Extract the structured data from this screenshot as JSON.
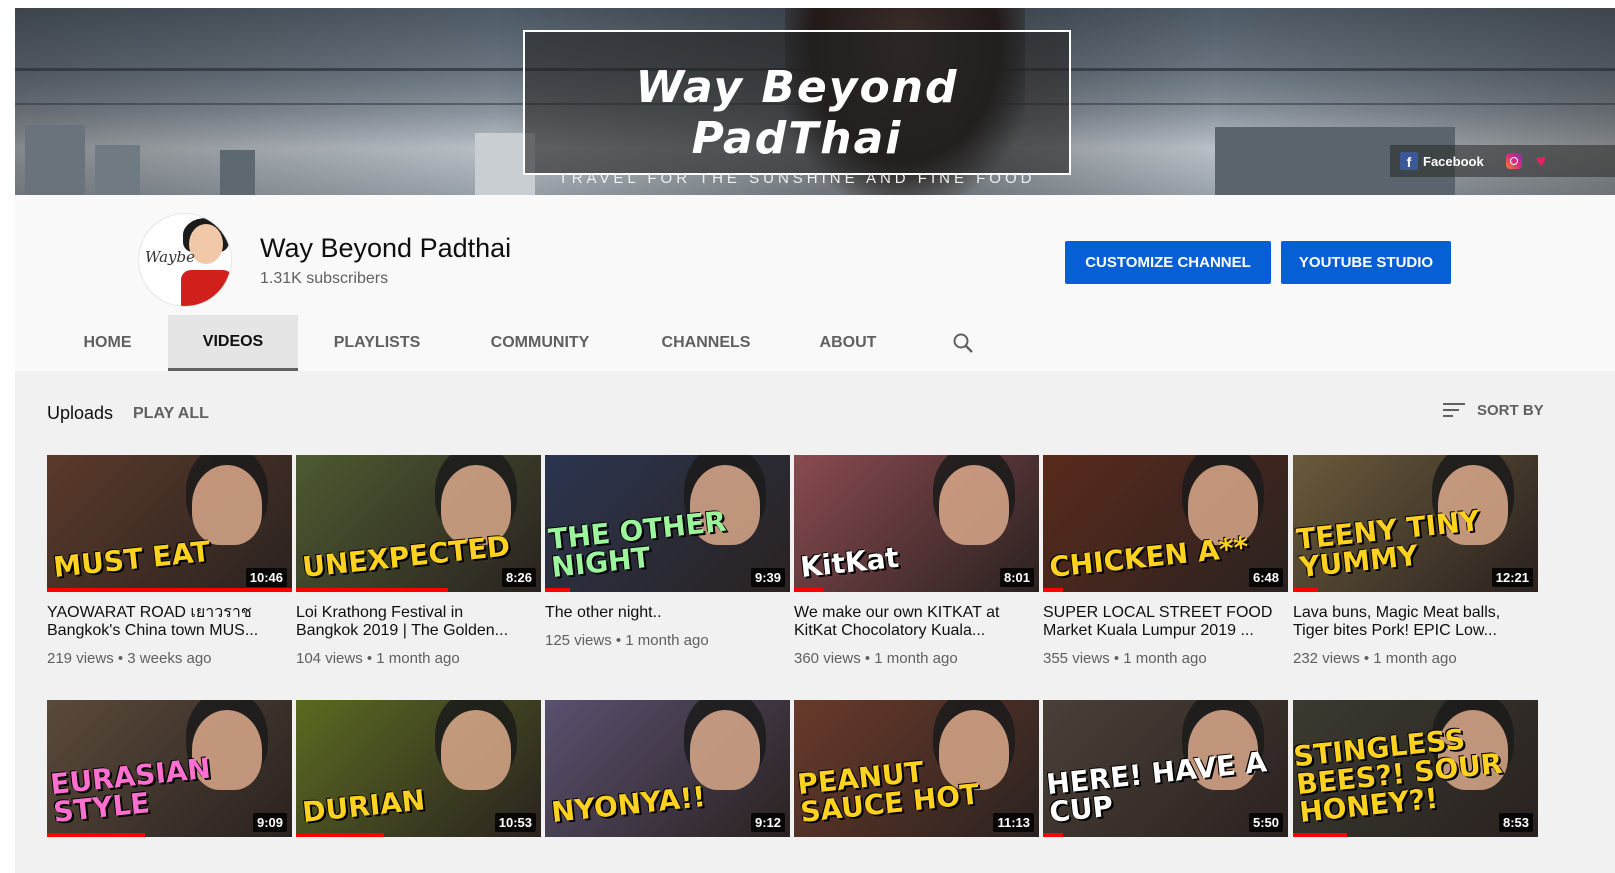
{
  "banner": {
    "title": "Way Beyond PadThai",
    "subtitle": "TRAVEL FOR THE SUNSHINE AND FINE FOOD",
    "links": {
      "facebook_label": "Facebook"
    }
  },
  "channel": {
    "name": "Way Beyond Padthai",
    "subscribers": "1.31K subscribers",
    "avatar_signature": "Waybe"
  },
  "actions": {
    "customize": "CUSTOMIZE CHANNEL",
    "studio": "YOUTUBE STUDIO"
  },
  "tabs": [
    {
      "label": "HOME"
    },
    {
      "label": "VIDEOS"
    },
    {
      "label": "PLAYLISTS"
    },
    {
      "label": "COMMUNITY"
    },
    {
      "label": "CHANNELS"
    },
    {
      "label": "ABOUT"
    }
  ],
  "section": {
    "title": "Uploads",
    "play_all": "PLAY ALL",
    "sort_by": "SORT BY"
  },
  "videos": [
    {
      "title": "YAOWARAT ROAD เยาวราช\nBangkok's China town MUS...",
      "views": "219 views",
      "age": "3 weeks ago",
      "duration": "10:46",
      "thumb_text": "MUST EAT",
      "thumb_color": "#ffd21f",
      "bg": "#5a3a2a",
      "progress": 1.0
    },
    {
      "title": "Loi Krathong Festival in\nBangkok 2019 | The Golden...",
      "views": "104 views",
      "age": "1 month ago",
      "duration": "8:26",
      "thumb_text": "UNEXPECTED",
      "thumb_color": "#ffd21f",
      "bg": "#4c5a30",
      "progress": 0.62
    },
    {
      "title": "The other night..",
      "views": "125 views",
      "age": "1 month ago",
      "duration": "9:39",
      "thumb_text": "THE OTHER NIGHT",
      "thumb_color": "#9cf59c",
      "bg": "#2b3550",
      "progress": 0.1
    },
    {
      "title": "We make our own KITKAT at\nKitKat Chocolatory Kuala...",
      "views": "360 views",
      "age": "1 month ago",
      "duration": "8:01",
      "thumb_text": "KitKat",
      "thumb_color": "#ffffff",
      "bg": "#8a4a50",
      "progress": 0.12
    },
    {
      "title": "SUPER LOCAL STREET FOOD\nMarket Kuala Lumpur 2019 ...",
      "views": "355 views",
      "age": "1 month ago",
      "duration": "6:48",
      "thumb_text": "CHICKEN A**",
      "thumb_color": "#ffd21f",
      "bg": "#5a2a1c",
      "progress": 0.08
    },
    {
      "title": "Lava buns, Magic Meat balls,\nTiger bites Pork! EPIC Low...",
      "views": "232 views",
      "age": "1 month ago",
      "duration": "12:21",
      "thumb_text": "TEENY TINY YUMMY",
      "thumb_color": "#ffd21f",
      "bg": "#6a5a3a",
      "progress": 0.1
    },
    {
      "title": "",
      "views": "",
      "age": "",
      "duration": "9:09",
      "thumb_text": "EURASIAN STYLE",
      "thumb_color": "#ff6fd0",
      "bg": "#5a4a3a",
      "progress": 0.4
    },
    {
      "title": "",
      "views": "",
      "age": "",
      "duration": "10:53",
      "thumb_text": "DURIAN",
      "thumb_color": "#ffd21f",
      "bg": "#5a6a20",
      "progress": 0.36
    },
    {
      "title": "",
      "views": "",
      "age": "",
      "duration": "9:12",
      "thumb_text": "NYONYA!!",
      "thumb_color": "#ffd21f",
      "bg": "#5a5070",
      "progress": 0.0
    },
    {
      "title": "",
      "views": "",
      "age": "",
      "duration": "11:13",
      "thumb_text": "PEANUT SAUCE HOT",
      "thumb_color": "#ffd21f",
      "bg": "#6a3a2a",
      "progress": 0.0
    },
    {
      "title": "",
      "views": "",
      "age": "",
      "duration": "5:50",
      "thumb_text": "HERE! HAVE A CUP",
      "thumb_color": "#ffffff",
      "bg": "#4a4038",
      "progress": 0.08
    },
    {
      "title": "",
      "views": "",
      "age": "",
      "duration": "8:53",
      "thumb_text": "STINGLESS BEES?! SOUR HONEY?!",
      "thumb_color": "#ffd21f",
      "bg": "#3a3a30",
      "progress": 0.22
    }
  ],
  "colors": {
    "accent": "#065fd4",
    "progress": "#ff0000"
  }
}
